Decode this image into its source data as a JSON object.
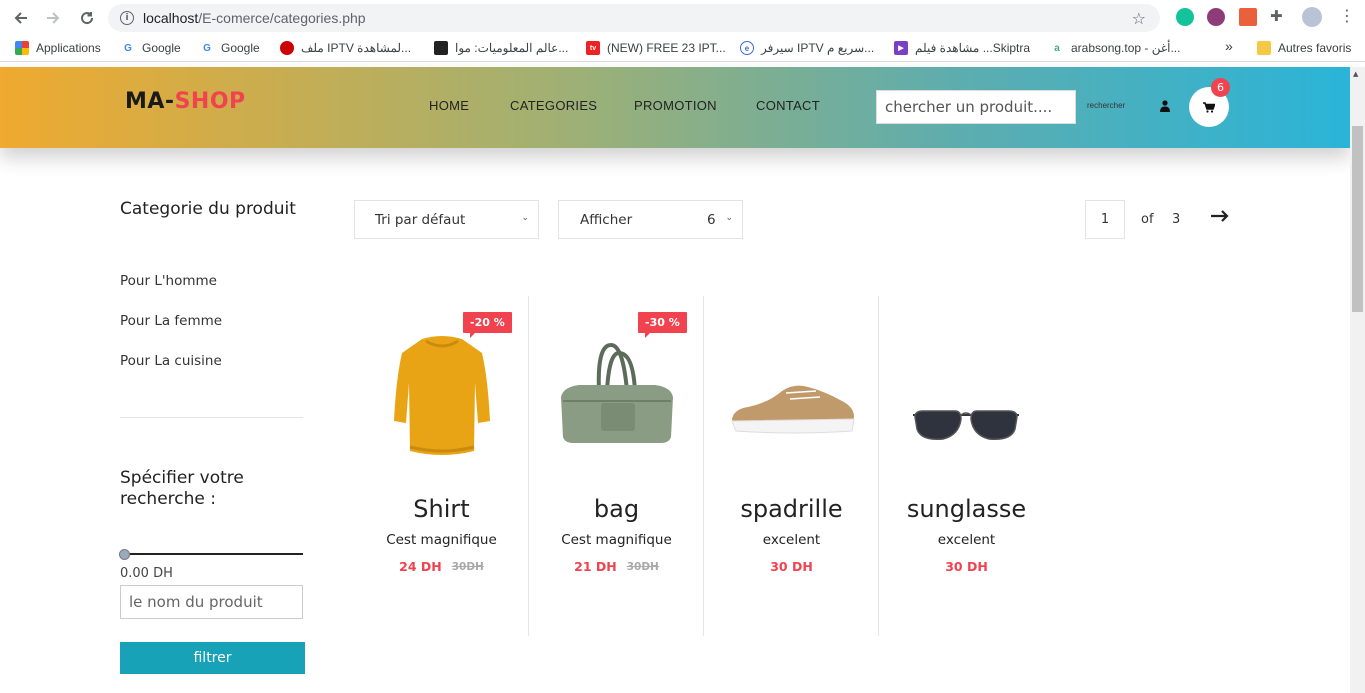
{
  "browser": {
    "url_host": "localhost",
    "url_path": "/E-comerce/categories.php",
    "bookmarks": [
      {
        "label": "Applications"
      },
      {
        "label": "Google"
      },
      {
        "label": "Google"
      },
      {
        "label": "ملف IPTV لمشاهدة..."
      },
      {
        "label": "عالم المعلوميات: موا..."
      },
      {
        "label": "(NEW) FREE 23 IPT..."
      },
      {
        "label": "سيرفر IPTV سريع م..."
      },
      {
        "label": "مشاهدة فيلم ...Skiptra"
      },
      {
        "label": "arabsong.top - أغن..."
      },
      {
        "label": "»"
      },
      {
        "label": "Autres favoris"
      }
    ]
  },
  "header": {
    "logo_part1": "MA-",
    "logo_part2": "SHOP",
    "nav": [
      "HOME",
      "CATEGORIES",
      "PROMOTION",
      "CONTACT"
    ],
    "search_placeholder": "chercher un produit....",
    "search_button": "rechercher",
    "cart_count": "6"
  },
  "sidebar": {
    "category_title": "Categorie du produit",
    "categories": [
      "Pour L'homme",
      "Pour La femme",
      "Pour La cuisine"
    ],
    "filter_title": "Spécifier votre recherche :",
    "price_value": "0.00 DH",
    "name_placeholder": "le nom du produit",
    "filter_button": "filtrer"
  },
  "toolbar": {
    "sort_label": "Tri par défaut",
    "show_label": "Afficher",
    "show_value": "6",
    "page_current": "1",
    "of_label": "of",
    "page_total": "3"
  },
  "products": [
    {
      "name": "Shirt",
      "desc": "Cest magnifique",
      "price": "24 DH",
      "old_price": "30DH",
      "badge": "-20 %"
    },
    {
      "name": "bag",
      "desc": "Cest magnifique",
      "price": "21 DH",
      "old_price": "30DH",
      "badge": "-30 %"
    },
    {
      "name": "spadrille",
      "desc": "excelent",
      "price": "30 DH",
      "old_price": "",
      "badge": ""
    },
    {
      "name": "sunglasse",
      "desc": "excelent",
      "price": "30 DH",
      "old_price": "",
      "badge": ""
    }
  ],
  "colors": {
    "accent": "#f0434f",
    "button": "#17a2b8"
  }
}
